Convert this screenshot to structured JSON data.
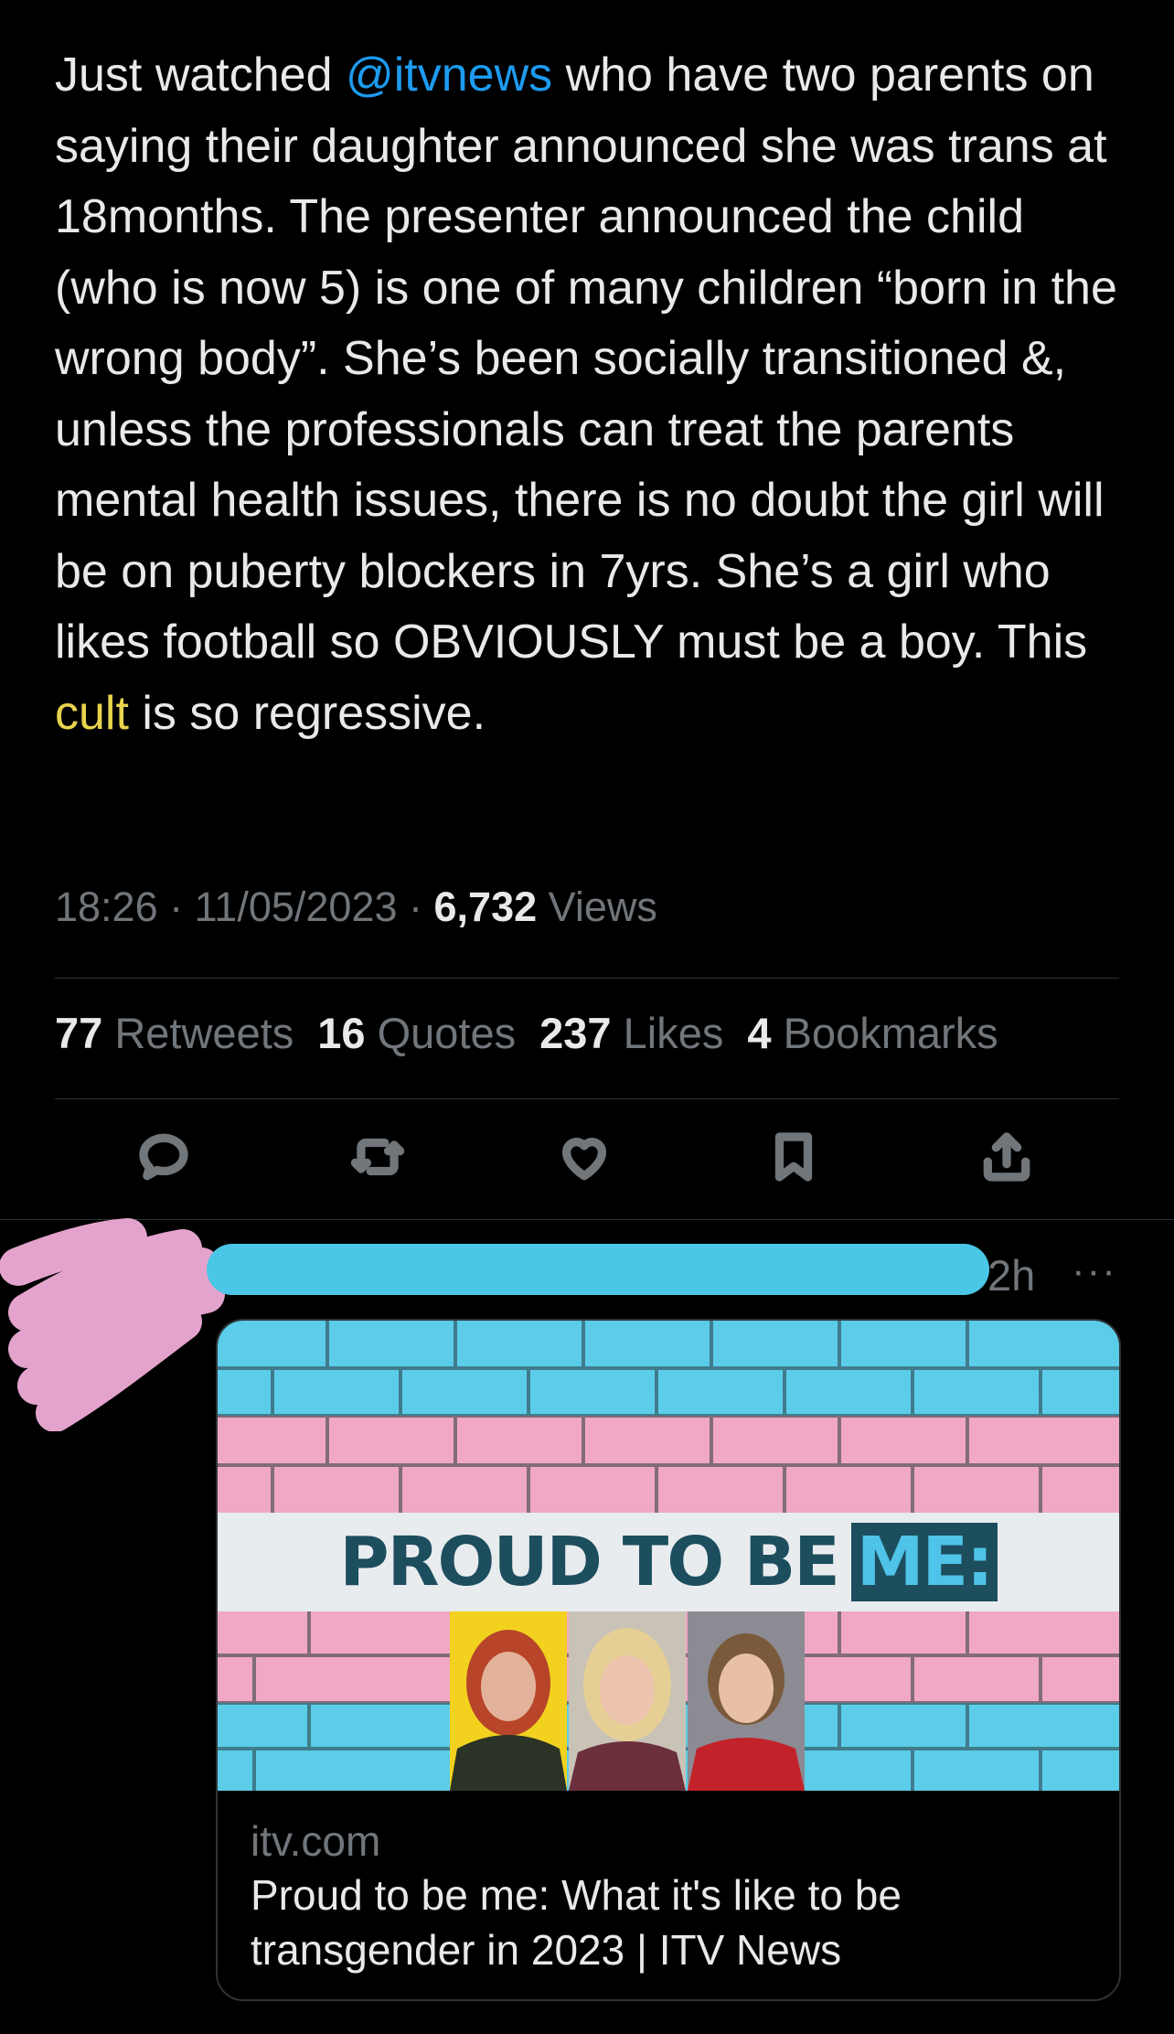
{
  "tweet": {
    "text_1": "Just watched ",
    "mention": "@itvnews",
    "text_2": " who have two parents on saying their daughter announced she was trans at 18months. The presenter announced the child (who is now 5) is one of many children “born in the wrong body”. She’s been socially transitioned &, unless the professionals can treat the parents mental health issues, there is no doubt the girl will be on puberty blockers in 7yrs. She’s a girl who likes football so OBVIOUSLY must be a boy. This ",
    "highlight": "cult",
    "text_3": " is so regressive.",
    "time": "18:26",
    "date": "11/05/2023",
    "views_count": "6,732",
    "views_label": "Views",
    "sep": " · "
  },
  "stats": {
    "retweets_count": "77",
    "retweets_label": "Retweets",
    "quotes_count": "16",
    "quotes_label": "Quotes",
    "likes_count": "237",
    "likes_label": "Likes",
    "bookmarks_count": "4",
    "bookmarks_label": "Bookmarks"
  },
  "actions": [
    "reply-icon",
    "retweet-icon",
    "like-icon",
    "bookmark-icon",
    "share-icon"
  ],
  "reply": {
    "time": "2h",
    "more": "···",
    "card": {
      "headline_main": "PROUD TO BE",
      "headline_box": "ME:",
      "domain": "itv.com",
      "title": "Proud to be me: What it's like to be transgender in 2023 | ITV News"
    }
  },
  "colors": {
    "background": "#000000",
    "text": "#e7e9ea",
    "secondary": "#71767b",
    "link": "#1d9bf0",
    "highlight": "#e8d44d",
    "redaction_blue": "#4ac6e6",
    "redaction_pink": "#e3a3cc",
    "trans_blue": "#5bcde8",
    "trans_pink": "#f0a8c4"
  }
}
